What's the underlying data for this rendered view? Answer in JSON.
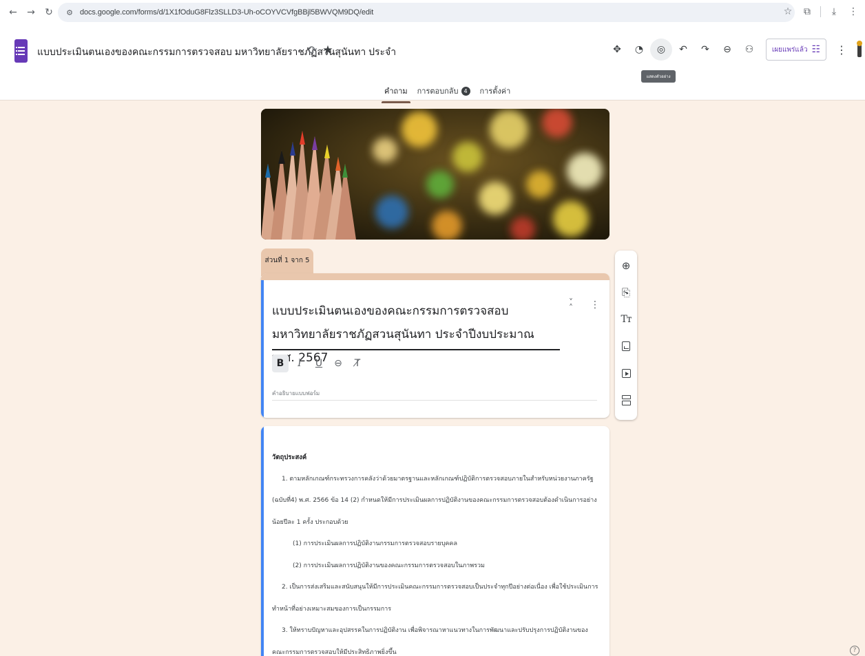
{
  "browser": {
    "url": "docs.google.com/forms/d/1X1fOduG8Flz3SLLD3-Uh-oCOYVCVfgBBjl5BWVQM9DQ/edit"
  },
  "header": {
    "title": "แบบประเมินตนเองของคณะกรรมการตรวจสอบ มหาวิทยาลัยราชภัฏสวนสุนันทา ประจำ",
    "publish_label": "เผยแพร่แล้ว",
    "tooltip": "แสดงตัวอย่าง"
  },
  "tabs": [
    {
      "label": "คำถาม"
    },
    {
      "label": "การตอบกลับ",
      "badge": "4"
    },
    {
      "label": "การตั้งค่า"
    }
  ],
  "section_label": "ส่วนที่ 1 จาก 5",
  "form": {
    "title": "แบบประเมินตนเองของคณะกรรมการตรวจสอบ มหาวิทยาลัยราชภัฏสวนสุนันทา ประจำปีงบประมาณ พ.ศ. 2567",
    "description_placeholder": "คำอธิบายแบบฟอร์ม"
  },
  "description": {
    "heading": "วัตถุประสงค์",
    "p1": "1. ตามหลักเกณฑ์กระทรวงการคลังว่าด้วยมาตรฐานและหลักเกณฑ์ปฏิบัติการตรวจสอบภายในสำหรับหน่วยงานภาครัฐ (ฉบับที่4) พ.ศ. 2566 ข้อ 14 (2) กำหนดให้มีการประเมินผลการปฏิบัติงานของคณะกรรมการตรวจสอบต้องดำเนินการอย่างน้อยปีละ 1 ครั้ง ประกอบด้วย",
    "p1a": "(1) การประเมินผลการปฏิบัติงานกรรมการตรวจสอบรายบุคคล",
    "p1b": "(2) การประเมินผลการปฏิบัติงานของคณะกรรมการตรวจสอบในภาพรวม",
    "p2": "2. เป็นการส่งเสริมและสนับสนุนให้มีการประเมินคณะกรรมการตรวจสอบเป็นประจำทุกปีอย่างต่อเนื่อง เพื่อใช้ประเมินการทำหน้าที่อย่างเหมาะสมของการเป็นกรรมการ",
    "p3": "3. ให้ทราบปัญหาและอุปสรรคในการปฏิบัติงาน เพื่อพิจารณาหาแนวทางในการพัฒนาและปรับปรุงการปฏิบัติงานของคณะกรรมการตรวจสอบให้มีประสิทธิภาพยิ่งขึ้น"
  },
  "colors": {
    "theme": "#e9c7ad",
    "background": "#fbf0e6",
    "accent": "#4285f4",
    "forms_purple": "#673ab7"
  },
  "icons": {
    "title_icons": [
      "add-to-drive-icon",
      "star-icon"
    ],
    "toolbar": [
      "addon-icon",
      "palette-icon",
      "preview-icon",
      "undo-icon",
      "redo-icon",
      "link-icon",
      "add-collaborator-icon"
    ],
    "side_toolbar": [
      "add-question-icon",
      "import-question-icon",
      "add-title-icon",
      "add-image-icon",
      "add-video-icon",
      "add-section-icon"
    ]
  }
}
